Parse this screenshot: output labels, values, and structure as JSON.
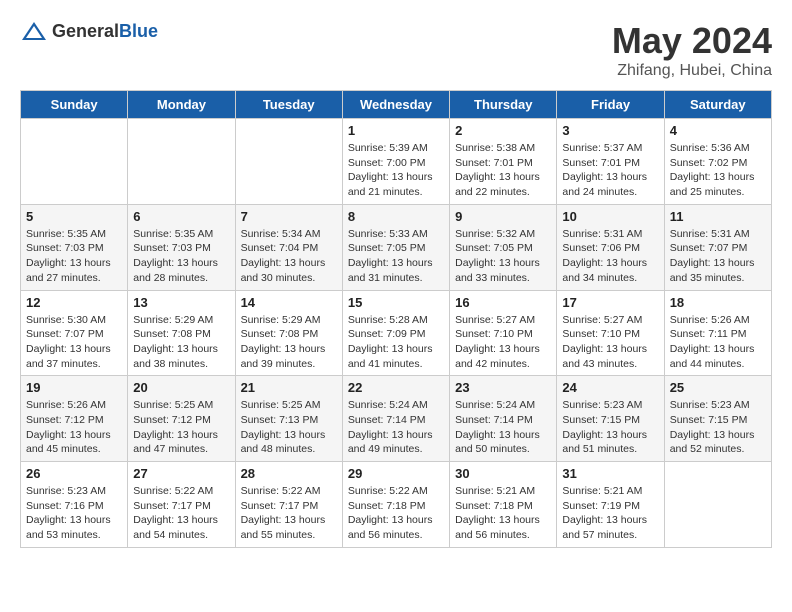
{
  "header": {
    "logo_general": "General",
    "logo_blue": "Blue",
    "month": "May 2024",
    "location": "Zhifang, Hubei, China"
  },
  "weekdays": [
    "Sunday",
    "Monday",
    "Tuesday",
    "Wednesday",
    "Thursday",
    "Friday",
    "Saturday"
  ],
  "weeks": [
    [
      {
        "day": "",
        "info": ""
      },
      {
        "day": "",
        "info": ""
      },
      {
        "day": "",
        "info": ""
      },
      {
        "day": "1",
        "info": "Sunrise: 5:39 AM\nSunset: 7:00 PM\nDaylight: 13 hours\nand 21 minutes."
      },
      {
        "day": "2",
        "info": "Sunrise: 5:38 AM\nSunset: 7:01 PM\nDaylight: 13 hours\nand 22 minutes."
      },
      {
        "day": "3",
        "info": "Sunrise: 5:37 AM\nSunset: 7:01 PM\nDaylight: 13 hours\nand 24 minutes."
      },
      {
        "day": "4",
        "info": "Sunrise: 5:36 AM\nSunset: 7:02 PM\nDaylight: 13 hours\nand 25 minutes."
      }
    ],
    [
      {
        "day": "5",
        "info": "Sunrise: 5:35 AM\nSunset: 7:03 PM\nDaylight: 13 hours\nand 27 minutes."
      },
      {
        "day": "6",
        "info": "Sunrise: 5:35 AM\nSunset: 7:03 PM\nDaylight: 13 hours\nand 28 minutes."
      },
      {
        "day": "7",
        "info": "Sunrise: 5:34 AM\nSunset: 7:04 PM\nDaylight: 13 hours\nand 30 minutes."
      },
      {
        "day": "8",
        "info": "Sunrise: 5:33 AM\nSunset: 7:05 PM\nDaylight: 13 hours\nand 31 minutes."
      },
      {
        "day": "9",
        "info": "Sunrise: 5:32 AM\nSunset: 7:05 PM\nDaylight: 13 hours\nand 33 minutes."
      },
      {
        "day": "10",
        "info": "Sunrise: 5:31 AM\nSunset: 7:06 PM\nDaylight: 13 hours\nand 34 minutes."
      },
      {
        "day": "11",
        "info": "Sunrise: 5:31 AM\nSunset: 7:07 PM\nDaylight: 13 hours\nand 35 minutes."
      }
    ],
    [
      {
        "day": "12",
        "info": "Sunrise: 5:30 AM\nSunset: 7:07 PM\nDaylight: 13 hours\nand 37 minutes."
      },
      {
        "day": "13",
        "info": "Sunrise: 5:29 AM\nSunset: 7:08 PM\nDaylight: 13 hours\nand 38 minutes."
      },
      {
        "day": "14",
        "info": "Sunrise: 5:29 AM\nSunset: 7:08 PM\nDaylight: 13 hours\nand 39 minutes."
      },
      {
        "day": "15",
        "info": "Sunrise: 5:28 AM\nSunset: 7:09 PM\nDaylight: 13 hours\nand 41 minutes."
      },
      {
        "day": "16",
        "info": "Sunrise: 5:27 AM\nSunset: 7:10 PM\nDaylight: 13 hours\nand 42 minutes."
      },
      {
        "day": "17",
        "info": "Sunrise: 5:27 AM\nSunset: 7:10 PM\nDaylight: 13 hours\nand 43 minutes."
      },
      {
        "day": "18",
        "info": "Sunrise: 5:26 AM\nSunset: 7:11 PM\nDaylight: 13 hours\nand 44 minutes."
      }
    ],
    [
      {
        "day": "19",
        "info": "Sunrise: 5:26 AM\nSunset: 7:12 PM\nDaylight: 13 hours\nand 45 minutes."
      },
      {
        "day": "20",
        "info": "Sunrise: 5:25 AM\nSunset: 7:12 PM\nDaylight: 13 hours\nand 47 minutes."
      },
      {
        "day": "21",
        "info": "Sunrise: 5:25 AM\nSunset: 7:13 PM\nDaylight: 13 hours\nand 48 minutes."
      },
      {
        "day": "22",
        "info": "Sunrise: 5:24 AM\nSunset: 7:14 PM\nDaylight: 13 hours\nand 49 minutes."
      },
      {
        "day": "23",
        "info": "Sunrise: 5:24 AM\nSunset: 7:14 PM\nDaylight: 13 hours\nand 50 minutes."
      },
      {
        "day": "24",
        "info": "Sunrise: 5:23 AM\nSunset: 7:15 PM\nDaylight: 13 hours\nand 51 minutes."
      },
      {
        "day": "25",
        "info": "Sunrise: 5:23 AM\nSunset: 7:15 PM\nDaylight: 13 hours\nand 52 minutes."
      }
    ],
    [
      {
        "day": "26",
        "info": "Sunrise: 5:23 AM\nSunset: 7:16 PM\nDaylight: 13 hours\nand 53 minutes."
      },
      {
        "day": "27",
        "info": "Sunrise: 5:22 AM\nSunset: 7:17 PM\nDaylight: 13 hours\nand 54 minutes."
      },
      {
        "day": "28",
        "info": "Sunrise: 5:22 AM\nSunset: 7:17 PM\nDaylight: 13 hours\nand 55 minutes."
      },
      {
        "day": "29",
        "info": "Sunrise: 5:22 AM\nSunset: 7:18 PM\nDaylight: 13 hours\nand 56 minutes."
      },
      {
        "day": "30",
        "info": "Sunrise: 5:21 AM\nSunset: 7:18 PM\nDaylight: 13 hours\nand 56 minutes."
      },
      {
        "day": "31",
        "info": "Sunrise: 5:21 AM\nSunset: 7:19 PM\nDaylight: 13 hours\nand 57 minutes."
      },
      {
        "day": "",
        "info": ""
      }
    ]
  ]
}
